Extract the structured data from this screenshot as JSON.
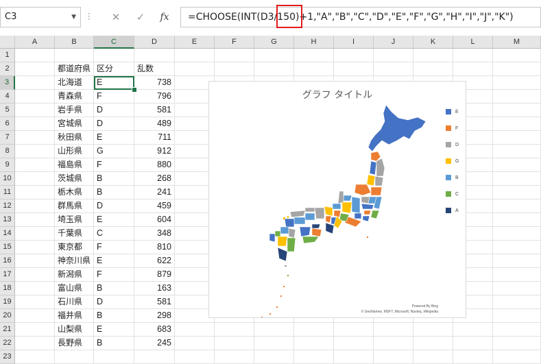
{
  "name_box": "C3",
  "formula_bar": {
    "cancel_glyph": "✕",
    "enter_glyph": "✓",
    "fx_label": "fx",
    "formula": "=CHOOSE(INT(D3/150)+1,\"A\",\"B\",\"C\",\"D\",\"E\",\"F\",\"G\",\"H\",\"I\",\"J\",\"K\")"
  },
  "columns": [
    "A",
    "B",
    "C",
    "D",
    "E",
    "F",
    "G",
    "H",
    "I",
    "J",
    "K",
    "L",
    "M"
  ],
  "rows": [
    "1",
    "2",
    "3",
    "4",
    "5",
    "6",
    "7",
    "8",
    "9",
    "10",
    "11",
    "12",
    "13",
    "14",
    "15",
    "16",
    "17",
    "18",
    "19",
    "20",
    "21",
    "22",
    "23"
  ],
  "headers": {
    "prefecture": "都道府県",
    "category": "区分",
    "random": "乱数"
  },
  "table": [
    {
      "pref": "北海道",
      "cat": "E",
      "num": "738"
    },
    {
      "pref": "青森県",
      "cat": "F",
      "num": "796"
    },
    {
      "pref": "岩手県",
      "cat": "D",
      "num": "581"
    },
    {
      "pref": "宮城県",
      "cat": "D",
      "num": "489"
    },
    {
      "pref": "秋田県",
      "cat": "E",
      "num": "711"
    },
    {
      "pref": "山形県",
      "cat": "G",
      "num": "912"
    },
    {
      "pref": "福島県",
      "cat": "F",
      "num": "880"
    },
    {
      "pref": "茨城県",
      "cat": "B",
      "num": "268"
    },
    {
      "pref": "栃木県",
      "cat": "B",
      "num": "241"
    },
    {
      "pref": "群馬県",
      "cat": "D",
      "num": "459"
    },
    {
      "pref": "埼玉県",
      "cat": "E",
      "num": "604"
    },
    {
      "pref": "千葉県",
      "cat": "C",
      "num": "348"
    },
    {
      "pref": "東京都",
      "cat": "F",
      "num": "810"
    },
    {
      "pref": "神奈川県",
      "cat": "E",
      "num": "622"
    },
    {
      "pref": "新潟県",
      "cat": "F",
      "num": "879"
    },
    {
      "pref": "富山県",
      "cat": "B",
      "num": "163"
    },
    {
      "pref": "石川県",
      "cat": "D",
      "num": "581"
    },
    {
      "pref": "福井県",
      "cat": "B",
      "num": "298"
    },
    {
      "pref": "山梨県",
      "cat": "E",
      "num": "683"
    },
    {
      "pref": "長野県",
      "cat": "B",
      "num": "245"
    }
  ],
  "chart": {
    "title": "グラフ タイトル",
    "legend": [
      {
        "label": "E",
        "color": "#4472c4"
      },
      {
        "label": "F",
        "color": "#ed7d31"
      },
      {
        "label": "D",
        "color": "#a5a5a5"
      },
      {
        "label": "G",
        "color": "#ffc000"
      },
      {
        "label": "B",
        "color": "#5b9bd5"
      },
      {
        "label": "C",
        "color": "#70ad47"
      },
      {
        "label": "A",
        "color": "#264478"
      }
    ],
    "powered_by": "Powered By Bing",
    "attribution": "© GeoNames, MSFT, Microsoft, Navteq, Wikipedia"
  }
}
